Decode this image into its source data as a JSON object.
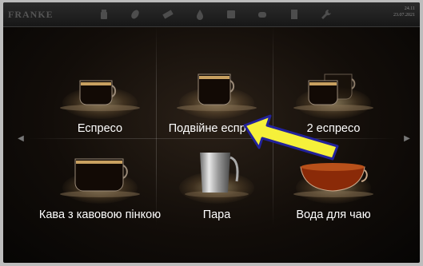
{
  "topbar": {
    "logo": "FRANKE",
    "date_line1": "24.11",
    "date_line2": "23.07.2021",
    "icons": [
      "milk-can-icon",
      "bean-icon",
      "chocolate-icon",
      "water-drop-icon",
      "grinder-icon",
      "cup-stack-icon",
      "service-icon",
      "wrench-icon"
    ]
  },
  "nav": {
    "left": "◀",
    "right": "▶"
  },
  "drinks": [
    {
      "label": "Еспресо"
    },
    {
      "label": "Подвійне еспресо"
    },
    {
      "label": "2 еспресо"
    },
    {
      "label": "Кава з кавовою пінкою"
    },
    {
      "label": "Пара"
    },
    {
      "label": "Вода для чаю"
    }
  ],
  "colors": {
    "pointer_arrow": "#f5f03a",
    "pointer_outline": "#22229a"
  }
}
